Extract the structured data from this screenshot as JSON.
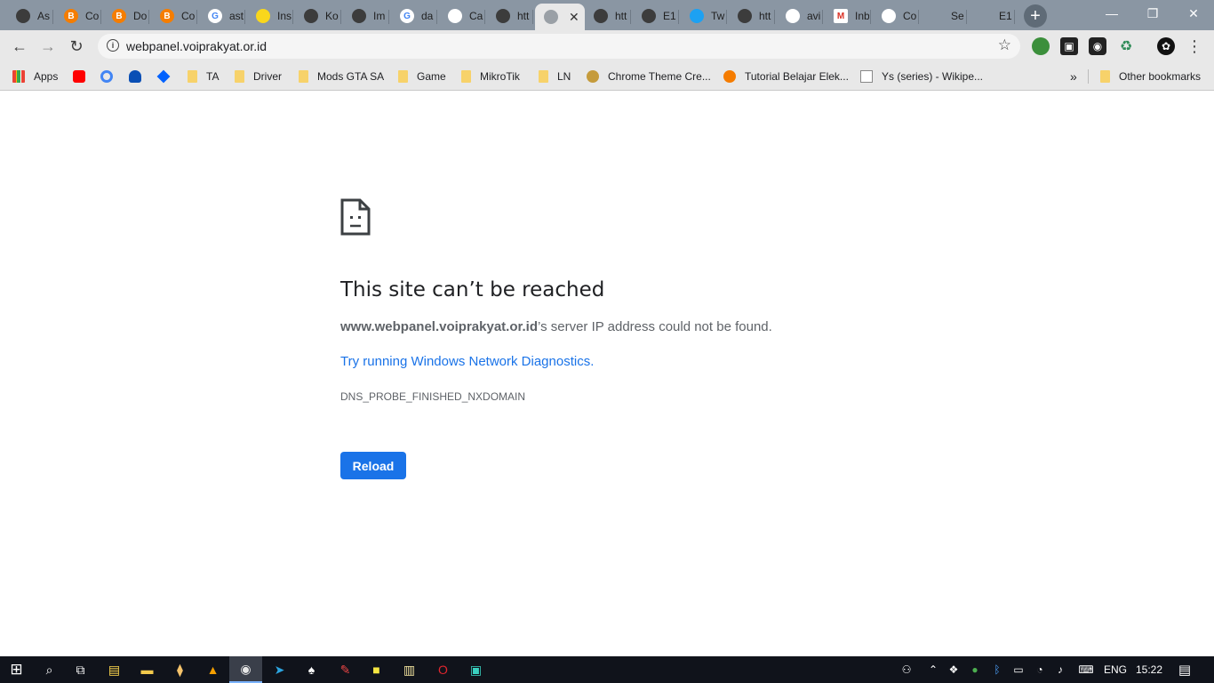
{
  "tabs": [
    {
      "title": "As",
      "icon": "globe-icon",
      "color": "#3c3c3c"
    },
    {
      "title": "Co",
      "icon": "blogger-icon",
      "color": "#f57d00"
    },
    {
      "title": "Do",
      "icon": "blogger-icon",
      "color": "#f57d00"
    },
    {
      "title": "Co",
      "icon": "blogger-icon",
      "color": "#f57d00"
    },
    {
      "title": "ast",
      "icon": "google-icon",
      "color": "#ffffff"
    },
    {
      "title": "Ins",
      "icon": "bulb-icon",
      "color": "#f9d71c"
    },
    {
      "title": "Ko",
      "icon": "globe-icon",
      "color": "#3c3c3c"
    },
    {
      "title": "Im",
      "icon": "globe-icon",
      "color": "#3c3c3c"
    },
    {
      "title": "da",
      "icon": "google-icon",
      "color": "#ffffff"
    },
    {
      "title": "Ca",
      "icon": "image-icon",
      "color": "#ffffff"
    },
    {
      "title": "htt",
      "icon": "globe-icon",
      "color": "#3c3c3c"
    },
    {
      "title": "",
      "icon": "globe-icon",
      "color": "#9aa0a6",
      "active": true
    },
    {
      "title": "htt",
      "icon": "globe-icon",
      "color": "#3c3c3c"
    },
    {
      "title": "E1",
      "icon": "globe-icon",
      "color": "#3c3c3c"
    },
    {
      "title": "Tw",
      "icon": "twitter-icon",
      "color": "#1da1f2"
    },
    {
      "title": "htt",
      "icon": "globe-icon",
      "color": "#3c3c3c"
    },
    {
      "title": "avi",
      "icon": "anime-icon",
      "color": "#ffffff"
    },
    {
      "title": "Inb",
      "icon": "gmail-icon",
      "color": "#ffffff"
    },
    {
      "title": "Co",
      "icon": "anime-icon",
      "color": "#ffffff"
    },
    {
      "title": "Se",
      "icon": "chat-icon",
      "color": "#8a96a3"
    },
    {
      "title": "E1",
      "icon": "chat-icon",
      "color": "#8a96a3"
    }
  ],
  "window": {
    "minimize": "—",
    "restore": "❐",
    "close": "✕"
  },
  "toolbar": {
    "url": "webpanel.voiprakyat.or.id",
    "back": "←",
    "forward": "→",
    "reload": "↻",
    "star": "☆",
    "menu": "⋮"
  },
  "bookmarks": [
    {
      "label": "Apps",
      "icon": "apps-grid-icon"
    },
    {
      "label": "",
      "icon": "youtube-icon"
    },
    {
      "label": "",
      "icon": "google-icon"
    },
    {
      "label": "",
      "icon": "onedrive-icon"
    },
    {
      "label": "",
      "icon": "dropbox-icon"
    },
    {
      "label": "TA",
      "icon": "folder-icon"
    },
    {
      "label": "Driver",
      "icon": "folder-icon"
    },
    {
      "label": "Mods GTA SA",
      "icon": "folder-icon"
    },
    {
      "label": "Game",
      "icon": "folder-icon"
    },
    {
      "label": "MikroTik",
      "icon": "folder-icon"
    },
    {
      "label": "LN",
      "icon": "folder-icon"
    },
    {
      "label": "Chrome Theme Cre...",
      "icon": "palette-icon"
    },
    {
      "label": "Tutorial Belajar Elek...",
      "icon": "bolt-icon"
    },
    {
      "label": "Ys (series) - Wikipe...",
      "icon": "wikipedia-icon"
    }
  ],
  "bookmarks_more": "»",
  "other_bookmarks": "Other bookmarks",
  "error": {
    "title": "This site can’t be reached",
    "host": "www.webpanel.voiprakyat.or.id",
    "message_rest": "’s server IP address could not be found.",
    "link": "Try running Windows Network Diagnostics.",
    "code": "DNS_PROBE_FINISHED_NXDOMAIN",
    "reload": "Reload"
  },
  "taskbar": {
    "language": "ENG",
    "time": "15:22"
  }
}
